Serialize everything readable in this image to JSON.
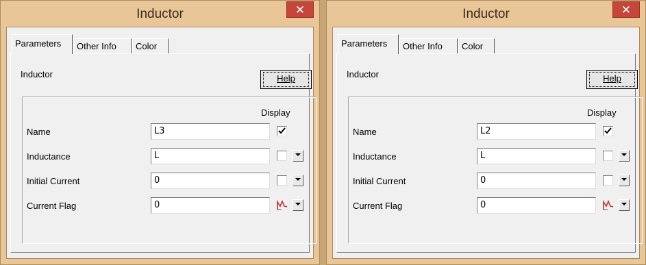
{
  "windows": [
    {
      "title": "Inductor",
      "close_glyph": "✕",
      "tabs": [
        "Parameters",
        "Other Info",
        "Color"
      ],
      "panel_label": "Inductor",
      "help_label": "Help",
      "display_header": "Display",
      "rows": [
        {
          "label": "Name",
          "value": "L3",
          "display": "checked"
        },
        {
          "label": "Inductance",
          "value": "L",
          "display": "unchecked"
        },
        {
          "label": "Initial Current",
          "value": "0",
          "display": "unchecked"
        },
        {
          "label": "Current Flag",
          "value": "0",
          "display": "flag-icon"
        }
      ]
    },
    {
      "title": "Inductor",
      "close_glyph": "✕",
      "tabs": [
        "Parameters",
        "Other Info",
        "Color"
      ],
      "panel_label": "Inductor",
      "help_label": "Help",
      "display_header": "Display",
      "rows": [
        {
          "label": "Name",
          "value": "L2",
          "display": "checked"
        },
        {
          "label": "Inductance",
          "value": "L",
          "display": "unchecked"
        },
        {
          "label": "Initial Current",
          "value": "0",
          "display": "unchecked"
        },
        {
          "label": "Current Flag",
          "value": "0",
          "display": "flag-icon"
        }
      ]
    }
  ],
  "colors": {
    "frame": "#e9c697",
    "close": "#c7463a",
    "client": "#f0f0f0"
  }
}
